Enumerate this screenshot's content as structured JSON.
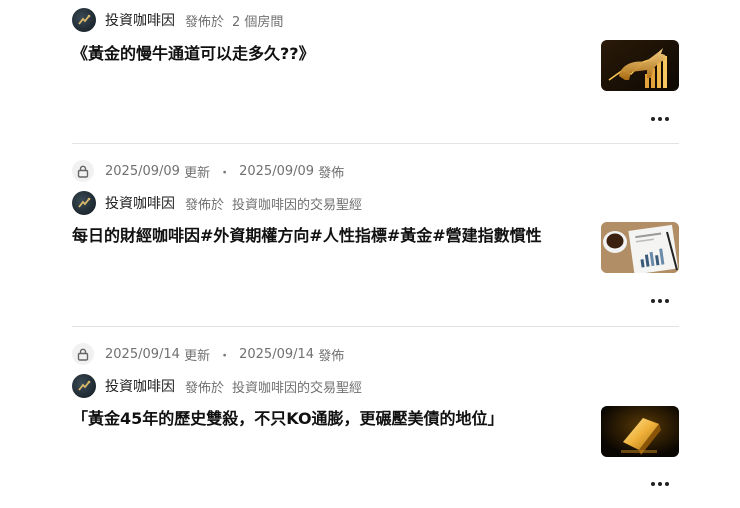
{
  "posts": [
    {
      "author": "投資咖啡因",
      "published_prefix": "發佈於",
      "room": "2 個房間",
      "title": "《黃金的慢牛通道可以走多久??》",
      "thumb_icon": "gold-bull-chart-image"
    },
    {
      "updated_date": "2025/09/09",
      "updated_label": "更新",
      "separator": "・",
      "published_date": "2025/09/09",
      "published_label": "發佈",
      "author": "投資咖啡因",
      "published_prefix": "發佈於",
      "room": "投資咖啡因的交易聖經",
      "title": "每日的財經咖啡因#外資期權方向#人性指標#黃金#營建指數慣性",
      "thumb_icon": "coffee-financial-report-image"
    },
    {
      "updated_date": "2025/09/14",
      "updated_label": "更新",
      "separator": "・",
      "published_date": "2025/09/14",
      "published_label": "發佈",
      "author": "投資咖啡因",
      "published_prefix": "發佈於",
      "room": "投資咖啡因的交易聖經",
      "title": "「黃金45年的歷史雙殺，不只KO通膨，更碾壓美債的地位」",
      "thumb_icon": "gold-bar-image"
    }
  ]
}
